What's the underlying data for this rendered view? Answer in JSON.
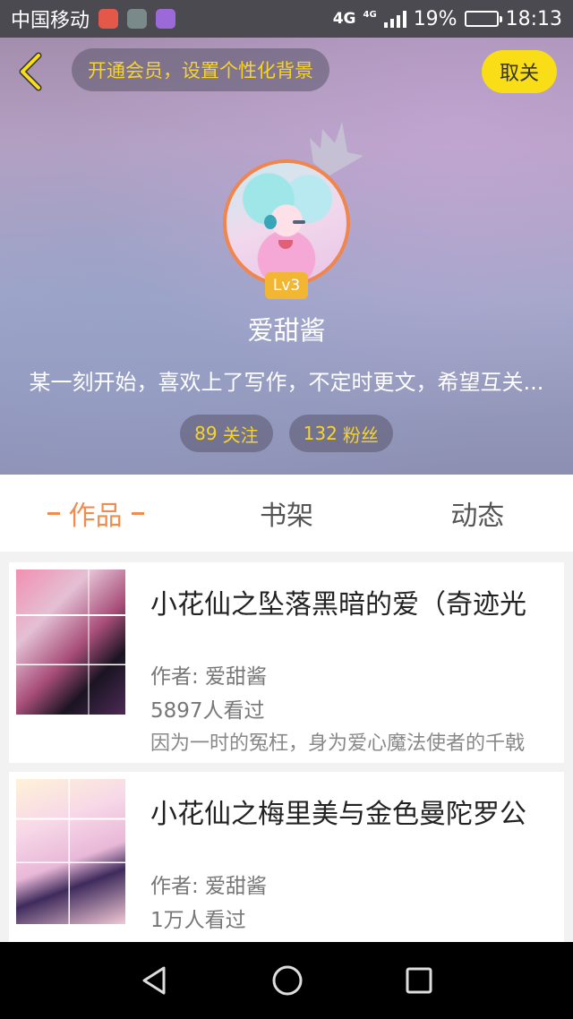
{
  "status_bar": {
    "carrier": "中国移动",
    "network_main": "4G",
    "network_sub": "4G",
    "battery_percent": "19%",
    "battery_level": 0.19,
    "time": "18:13",
    "notification_icons": [
      "mail-app-icon",
      "game-app-icon",
      "gallery-app-icon"
    ]
  },
  "header": {
    "vip_promo": "开通会员，设置个性化背景",
    "unfollow_label": "取关",
    "level": "Lv3",
    "username": "爱甜酱",
    "bio": "某一刻开始，喜欢上了写作，不定时更文，希望互关...",
    "following_count": "89",
    "following_label": "关注",
    "followers_count": "132",
    "followers_label": "粉丝",
    "accent_yellow": "#f9dd16",
    "avatar_border": "#f0864e"
  },
  "tabs": [
    {
      "label": "作品",
      "active": true
    },
    {
      "label": "书架",
      "active": false
    },
    {
      "label": "动态",
      "active": false
    }
  ],
  "works": [
    {
      "title": "小花仙之坠落黑暗的爱（奇迹光",
      "author": "作者: 爱甜酱",
      "views": "5897人看过",
      "description": "因为一时的冤枉，身为爱心魔法使者的千戟"
    },
    {
      "title": "小花仙之梅里美与金色曼陀罗公",
      "author": "作者: 爱甜酱",
      "views": "1万人看过",
      "description": ""
    }
  ],
  "nav": {
    "icons": [
      "back-triangle-icon",
      "home-circle-icon",
      "recents-square-icon"
    ]
  }
}
